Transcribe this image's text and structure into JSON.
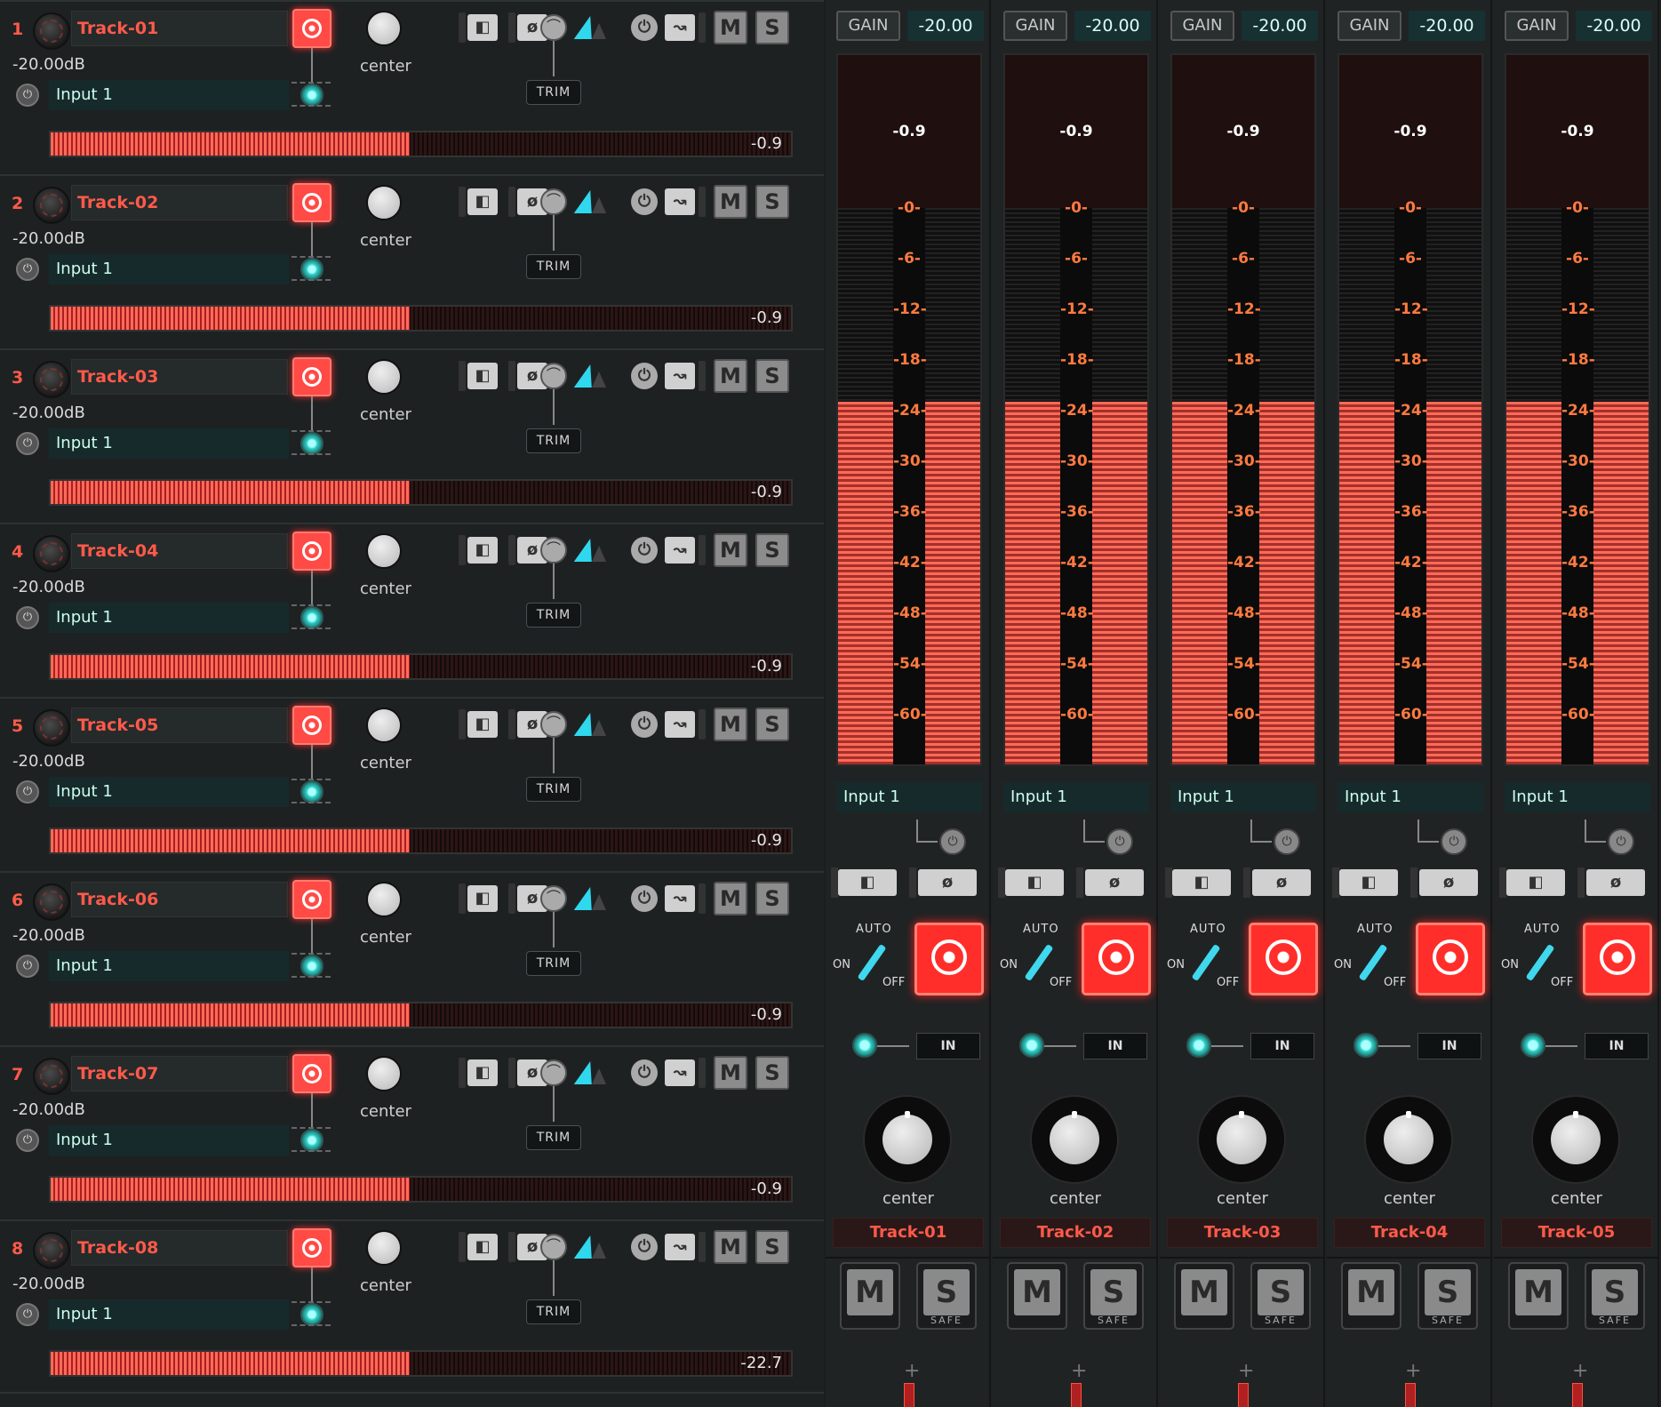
{
  "tracks": [
    {
      "num": "1",
      "name": "Track-01",
      "gain": "-20.00dB",
      "input": "Input 1",
      "pan": "center",
      "trim": "TRIM",
      "mute": "M",
      "solo": "S",
      "meter_value": "-0.9",
      "meter_level": 0.485
    },
    {
      "num": "2",
      "name": "Track-02",
      "gain": "-20.00dB",
      "input": "Input 1",
      "pan": "center",
      "trim": "TRIM",
      "mute": "M",
      "solo": "S",
      "meter_value": "-0.9",
      "meter_level": 0.485
    },
    {
      "num": "3",
      "name": "Track-03",
      "gain": "-20.00dB",
      "input": "Input 1",
      "pan": "center",
      "trim": "TRIM",
      "mute": "M",
      "solo": "S",
      "meter_value": "-0.9",
      "meter_level": 0.485
    },
    {
      "num": "4",
      "name": "Track-04",
      "gain": "-20.00dB",
      "input": "Input 1",
      "pan": "center",
      "trim": "TRIM",
      "mute": "M",
      "solo": "S",
      "meter_value": "-0.9",
      "meter_level": 0.485
    },
    {
      "num": "5",
      "name": "Track-05",
      "gain": "-20.00dB",
      "input": "Input 1",
      "pan": "center",
      "trim": "TRIM",
      "mute": "M",
      "solo": "S",
      "meter_value": "-0.9",
      "meter_level": 0.485
    },
    {
      "num": "6",
      "name": "Track-06",
      "gain": "-20.00dB",
      "input": "Input 1",
      "pan": "center",
      "trim": "TRIM",
      "mute": "M",
      "solo": "S",
      "meter_value": "-0.9",
      "meter_level": 0.485
    },
    {
      "num": "7",
      "name": "Track-07",
      "gain": "-20.00dB",
      "input": "Input 1",
      "pan": "center",
      "trim": "TRIM",
      "mute": "M",
      "solo": "S",
      "meter_value": "-0.9",
      "meter_level": 0.485
    },
    {
      "num": "8",
      "name": "Track-08",
      "gain": "-20.00dB",
      "input": "Input 1",
      "pan": "center",
      "trim": "TRIM",
      "mute": "M",
      "solo": "S",
      "meter_value": "-22.7",
      "meter_level": 0.485
    }
  ],
  "strips": [
    {
      "gain_label": "GAIN",
      "gain_value": "-20.00",
      "peak": "-0.9",
      "input": "Input 1",
      "auto": "AUTO",
      "on": "ON",
      "off": "OFF",
      "in": "IN",
      "pan": "center",
      "name": "Track-01",
      "mute": "M",
      "solo": "S",
      "safe": "SAFE",
      "meter_level_db": -24
    },
    {
      "gain_label": "GAIN",
      "gain_value": "-20.00",
      "peak": "-0.9",
      "input": "Input 1",
      "auto": "AUTO",
      "on": "ON",
      "off": "OFF",
      "in": "IN",
      "pan": "center",
      "name": "Track-02",
      "mute": "M",
      "solo": "S",
      "safe": "SAFE",
      "meter_level_db": -24
    },
    {
      "gain_label": "GAIN",
      "gain_value": "-20.00",
      "peak": "-0.9",
      "input": "Input 1",
      "auto": "AUTO",
      "on": "ON",
      "off": "OFF",
      "in": "IN",
      "pan": "center",
      "name": "Track-03",
      "mute": "M",
      "solo": "S",
      "safe": "SAFE",
      "meter_level_db": -24
    },
    {
      "gain_label": "GAIN",
      "gain_value": "-20.00",
      "peak": "-0.9",
      "input": "Input 1",
      "auto": "AUTO",
      "on": "ON",
      "off": "OFF",
      "in": "IN",
      "pan": "center",
      "name": "Track-04",
      "mute": "M",
      "solo": "S",
      "safe": "SAFE",
      "meter_level_db": -24
    },
    {
      "gain_label": "GAIN",
      "gain_value": "-20.00",
      "peak": "-0.9",
      "input": "Input 1",
      "auto": "AUTO",
      "on": "ON",
      "off": "OFF",
      "in": "IN",
      "pan": "center",
      "name": "Track-05",
      "mute": "M",
      "solo": "S",
      "safe": "SAFE",
      "meter_level_db": -24
    }
  ],
  "meter_scale": [
    "-0-",
    "-6-",
    "-12-",
    "-18-",
    "-24-",
    "-30-",
    "-36-",
    "-42-",
    "-48-",
    "-54-",
    "-60-"
  ],
  "icons": {
    "rec": "record-icon",
    "pan": "pan-knob",
    "monitor": "monitor-led-icon",
    "input": "input-icon",
    "phase": "phase-invert-icon",
    "trim": "trim-knob-icon",
    "automation": "automation-icon"
  },
  "colors": {
    "accent_red": "#ff4a45",
    "track_name": "#ff5a4a",
    "cyan": "#2fd8ee",
    "meter_fill": "#ff6a58"
  }
}
